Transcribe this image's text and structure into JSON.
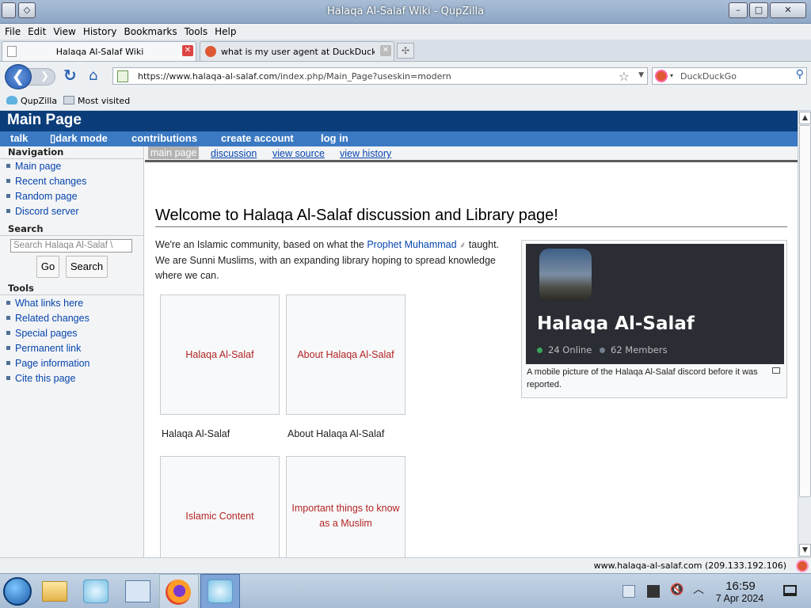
{
  "window": {
    "title": "Halaqa Al-Salaf Wiki - QupZilla",
    "min_glyph": "–",
    "max_glyph": "□",
    "close_glyph": "✕"
  },
  "menu": [
    "File",
    "Edit",
    "View",
    "History",
    "Bookmarks",
    "Tools",
    "Help"
  ],
  "tabs": [
    {
      "label": "Halaqa Al-Salaf Wiki",
      "close": "✕"
    },
    {
      "label": "what is my user agent at DuckDuckGo",
      "close": "✕"
    }
  ],
  "newtab_glyph": "✣",
  "nav": {
    "back_glyph": "❮",
    "forward_glyph": "❯",
    "reload_glyph": "↻",
    "home_glyph": "⌂",
    "url_host": "https://www.halaqa-al-salaf.com",
    "url_path": "/index.php/Main_Page?useskin=modern",
    "star_glyph": "☆",
    "dropdown_glyph": "▼",
    "search_engine": "DuckDuckGo",
    "search_caret": "▾",
    "search_icon": "⚲"
  },
  "bookmarks": [
    {
      "label": "QupZilla"
    },
    {
      "label": "Most visited"
    }
  ],
  "site": {
    "title": "Main Page",
    "userbar": [
      "talk",
      "▯dark mode",
      "contributions",
      "create account",
      "log in"
    ]
  },
  "sidebar": {
    "navigation_heading": "Navigation",
    "navigation": [
      "Main page",
      "Recent changes",
      "Random page",
      "Discord server"
    ],
    "search_heading": "Search",
    "search_placeholder": "Search Halaqa Al-Salaf \\",
    "go_label": "Go",
    "search_label": "Search",
    "tools_heading": "Tools",
    "tools": [
      "What links here",
      "Related changes",
      "Special pages",
      "Permanent link",
      "Page information",
      "Cite this page"
    ]
  },
  "content_tabs": [
    "main page",
    "discussion",
    "view source",
    "view history"
  ],
  "content": {
    "heading": "Welcome to Halaqa Al-Salaf discussion and Library page!",
    "intro_before": "We're an Islamic community, based on what the ",
    "intro_link": "Prophet Muhammad",
    "intro_link_icon": "⸙",
    "intro_after": " taught. We are Sunni Muslims, with an expanding library hoping to spread knowledge where we can.",
    "boxes": [
      {
        "label": "Halaqa Al-Salaf",
        "caption": "Halaqa Al-Salaf"
      },
      {
        "label": "About Halaqa Al-Salaf",
        "caption": "About Halaqa Al-Salaf"
      },
      {
        "label": "Islamic Content",
        "caption": ""
      },
      {
        "label": "Important things to know as a Muslim",
        "caption": ""
      }
    ],
    "figure": {
      "server_name": "Halaqa Al-Salaf",
      "online": "24 Online",
      "members": "62 Members",
      "caption": "A mobile picture of the Halaqa Al-Salaf discord before it was reported."
    }
  },
  "status": {
    "text": "www.halaqa-al-salaf.com (209.133.192.106)"
  },
  "taskbar": {
    "time": "16:59",
    "date": "7 Apr 2024"
  }
}
